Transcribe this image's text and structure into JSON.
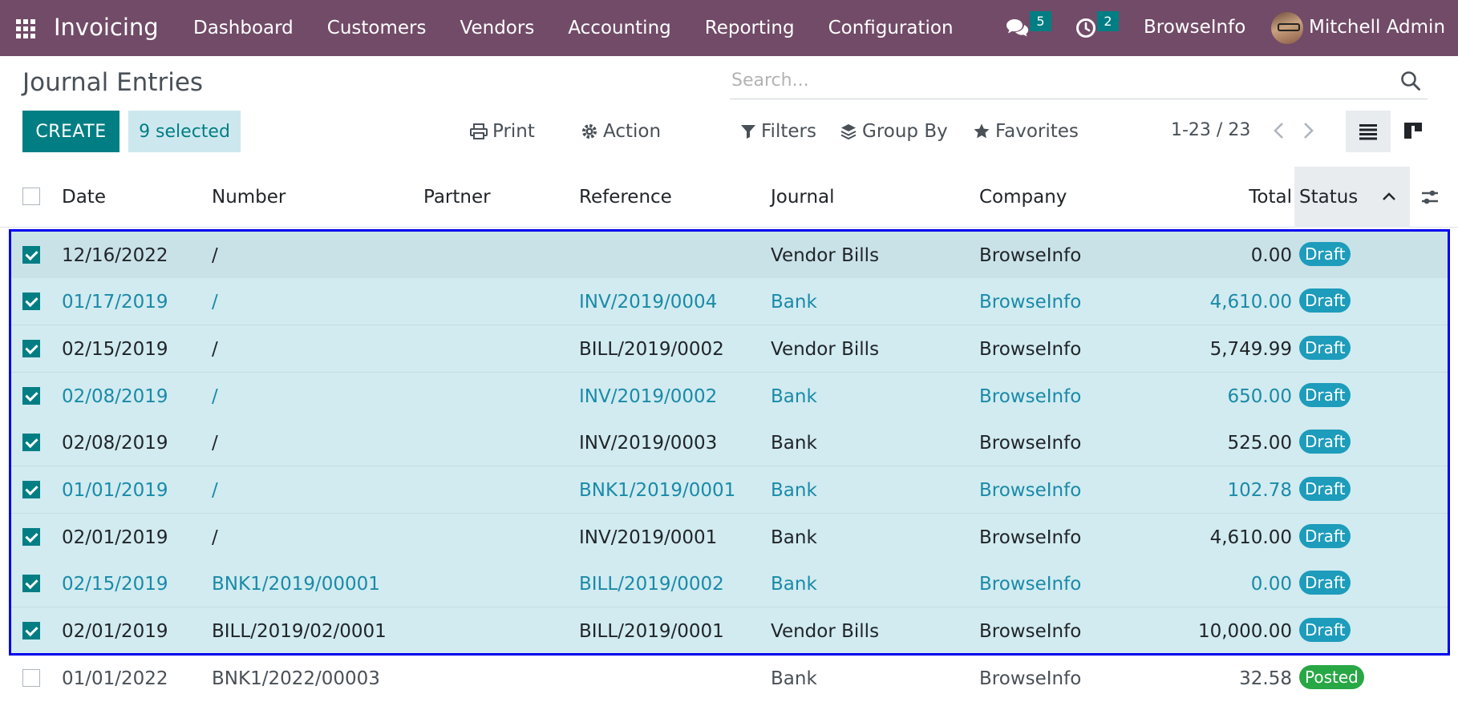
{
  "navbar": {
    "app_title": "Invoicing",
    "menu": [
      "Dashboard",
      "Customers",
      "Vendors",
      "Accounting",
      "Reporting",
      "Configuration"
    ],
    "messages_count": "5",
    "activities_count": "2",
    "company": "BrowseInfo",
    "user": "Mitchell Admin",
    "brand_color": "#714b67"
  },
  "control": {
    "page_title": "Journal Entries",
    "search_placeholder": "Search...",
    "create_label": "CREATE",
    "selected_label": "9 selected",
    "print_label": "Print",
    "action_label": "Action",
    "filters_label": "Filters",
    "groupby_label": "Group By",
    "favorites_label": "Favorites",
    "pager": "1-23 / 23"
  },
  "table": {
    "headers": {
      "date": "Date",
      "number": "Number",
      "partner": "Partner",
      "reference": "Reference",
      "journal": "Journal",
      "company": "Company",
      "total": "Total",
      "status": "Status"
    },
    "rows": [
      {
        "date": "12/16/2022",
        "number": "/",
        "partner": "",
        "reference": "",
        "journal": "Vendor Bills",
        "company": "BrowseInfo",
        "total": "0.00",
        "status": "Draft"
      },
      {
        "date": "01/17/2019",
        "number": "/",
        "partner": "",
        "reference": "INV/2019/0004",
        "journal": "Bank",
        "company": "BrowseInfo",
        "total": "4,610.00",
        "status": "Draft"
      },
      {
        "date": "02/15/2019",
        "number": "/",
        "partner": "",
        "reference": "BILL/2019/0002",
        "journal": "Vendor Bills",
        "company": "BrowseInfo",
        "total": "5,749.99",
        "status": "Draft"
      },
      {
        "date": "02/08/2019",
        "number": "/",
        "partner": "",
        "reference": "INV/2019/0002",
        "journal": "Bank",
        "company": "BrowseInfo",
        "total": "650.00",
        "status": "Draft"
      },
      {
        "date": "02/08/2019",
        "number": "/",
        "partner": "",
        "reference": "INV/2019/0003",
        "journal": "Bank",
        "company": "BrowseInfo",
        "total": "525.00",
        "status": "Draft"
      },
      {
        "date": "01/01/2019",
        "number": "/",
        "partner": "",
        "reference": "BNK1/2019/0001",
        "journal": "Bank",
        "company": "BrowseInfo",
        "total": "102.78",
        "status": "Draft"
      },
      {
        "date": "02/01/2019",
        "number": "/",
        "partner": "",
        "reference": "INV/2019/0001",
        "journal": "Bank",
        "company": "BrowseInfo",
        "total": "4,610.00",
        "status": "Draft"
      },
      {
        "date": "02/15/2019",
        "number": "BNK1/2019/00001",
        "partner": "",
        "reference": "BILL/2019/0002",
        "journal": "Bank",
        "company": "BrowseInfo",
        "total": "0.00",
        "status": "Draft"
      },
      {
        "date": "02/01/2019",
        "number": "BILL/2019/02/0001",
        "partner": "",
        "reference": "BILL/2019/0001",
        "journal": "Vendor Bills",
        "company": "BrowseInfo",
        "total": "10,000.00",
        "status": "Draft"
      },
      {
        "date": "01/01/2022",
        "number": "BNK1/2022/00003",
        "partner": "",
        "reference": "",
        "journal": "Bank",
        "company": "BrowseInfo",
        "total": "32.58",
        "status": "Posted"
      }
    ]
  }
}
